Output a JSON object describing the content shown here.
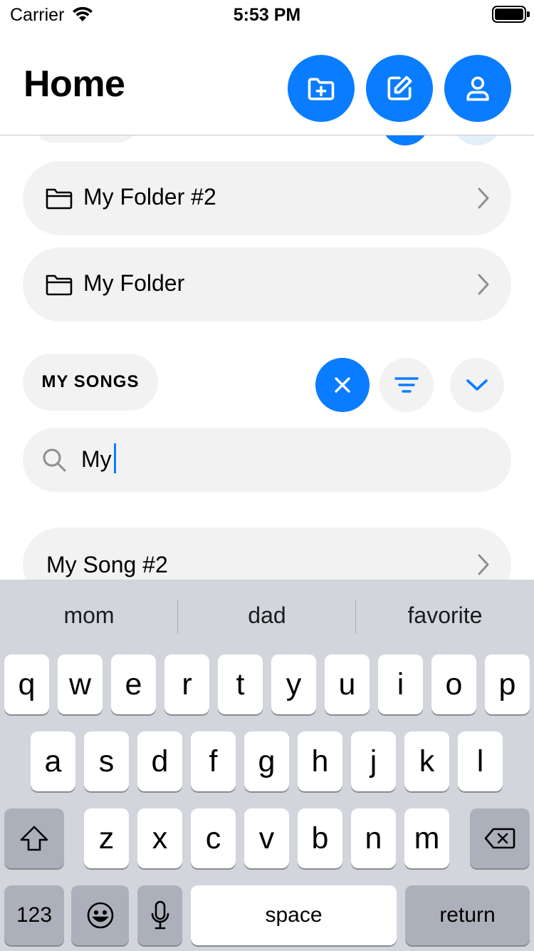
{
  "status_bar": {
    "carrier": "Carrier",
    "time": "5:53 PM"
  },
  "header": {
    "title": "Home",
    "buttons": [
      "new-folder-icon",
      "edit-icon",
      "profile-icon"
    ]
  },
  "folders": [
    {
      "label": "My Folder #2",
      "icon": "folder-icon"
    },
    {
      "label": "My Folder",
      "icon": "folder-icon"
    }
  ],
  "songs_section": {
    "title": "MY SONGS",
    "controls": [
      "close-icon",
      "filter-icon",
      "chevron-down-icon"
    ]
  },
  "search": {
    "value": "My"
  },
  "songs": [
    {
      "label": "My Song #2"
    }
  ],
  "keyboard": {
    "suggestions": [
      "mom",
      "dad",
      "favorite"
    ],
    "row1": [
      "q",
      "w",
      "e",
      "r",
      "t",
      "y",
      "u",
      "i",
      "o",
      "p"
    ],
    "row2": [
      "a",
      "s",
      "d",
      "f",
      "g",
      "h",
      "j",
      "k",
      "l"
    ],
    "row3": [
      "z",
      "x",
      "c",
      "v",
      "b",
      "n",
      "m"
    ],
    "numbers_label": "123",
    "space_label": "space",
    "return_label": "return"
  },
  "colors": {
    "accent": "#0a7cff",
    "row_background": "#f2f2f3",
    "keyboard_background": "#d2d5db"
  }
}
